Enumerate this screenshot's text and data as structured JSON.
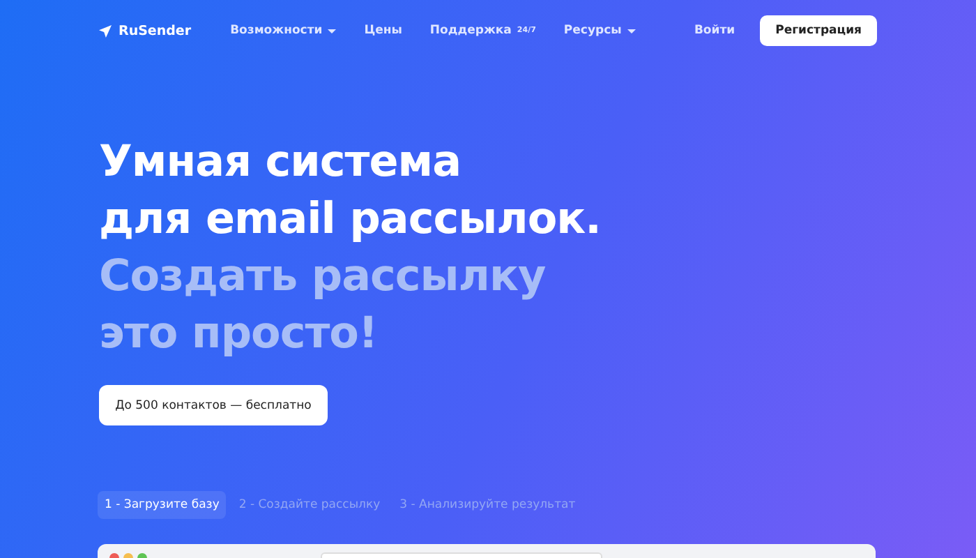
{
  "header": {
    "logo": "RuSender",
    "nav": [
      {
        "label": "Возможности",
        "dropdown": true
      },
      {
        "label": "Цены",
        "dropdown": false
      },
      {
        "label": "Поддержка",
        "dropdown": false,
        "badge": "24/7"
      },
      {
        "label": "Ресурсы",
        "dropdown": true
      }
    ],
    "login": "Войти",
    "register": "Регистрация"
  },
  "hero": {
    "lines": [
      {
        "text": "Умная система",
        "muted": false
      },
      {
        "text": "для email рассылок.",
        "muted": false
      },
      {
        "text": "Создать рассылку",
        "muted": true
      },
      {
        "text": "это просто!",
        "muted": true
      }
    ],
    "cta": "До 500 контактов — бесплатно"
  },
  "steps": [
    {
      "label": "1 - Загрузите базу",
      "selected": true
    },
    {
      "label": "2 - Создайте рассылку",
      "selected": false
    },
    {
      "label": "3 - Анализируйте результат",
      "selected": false
    }
  ],
  "preview": {
    "kind": "browser"
  }
}
